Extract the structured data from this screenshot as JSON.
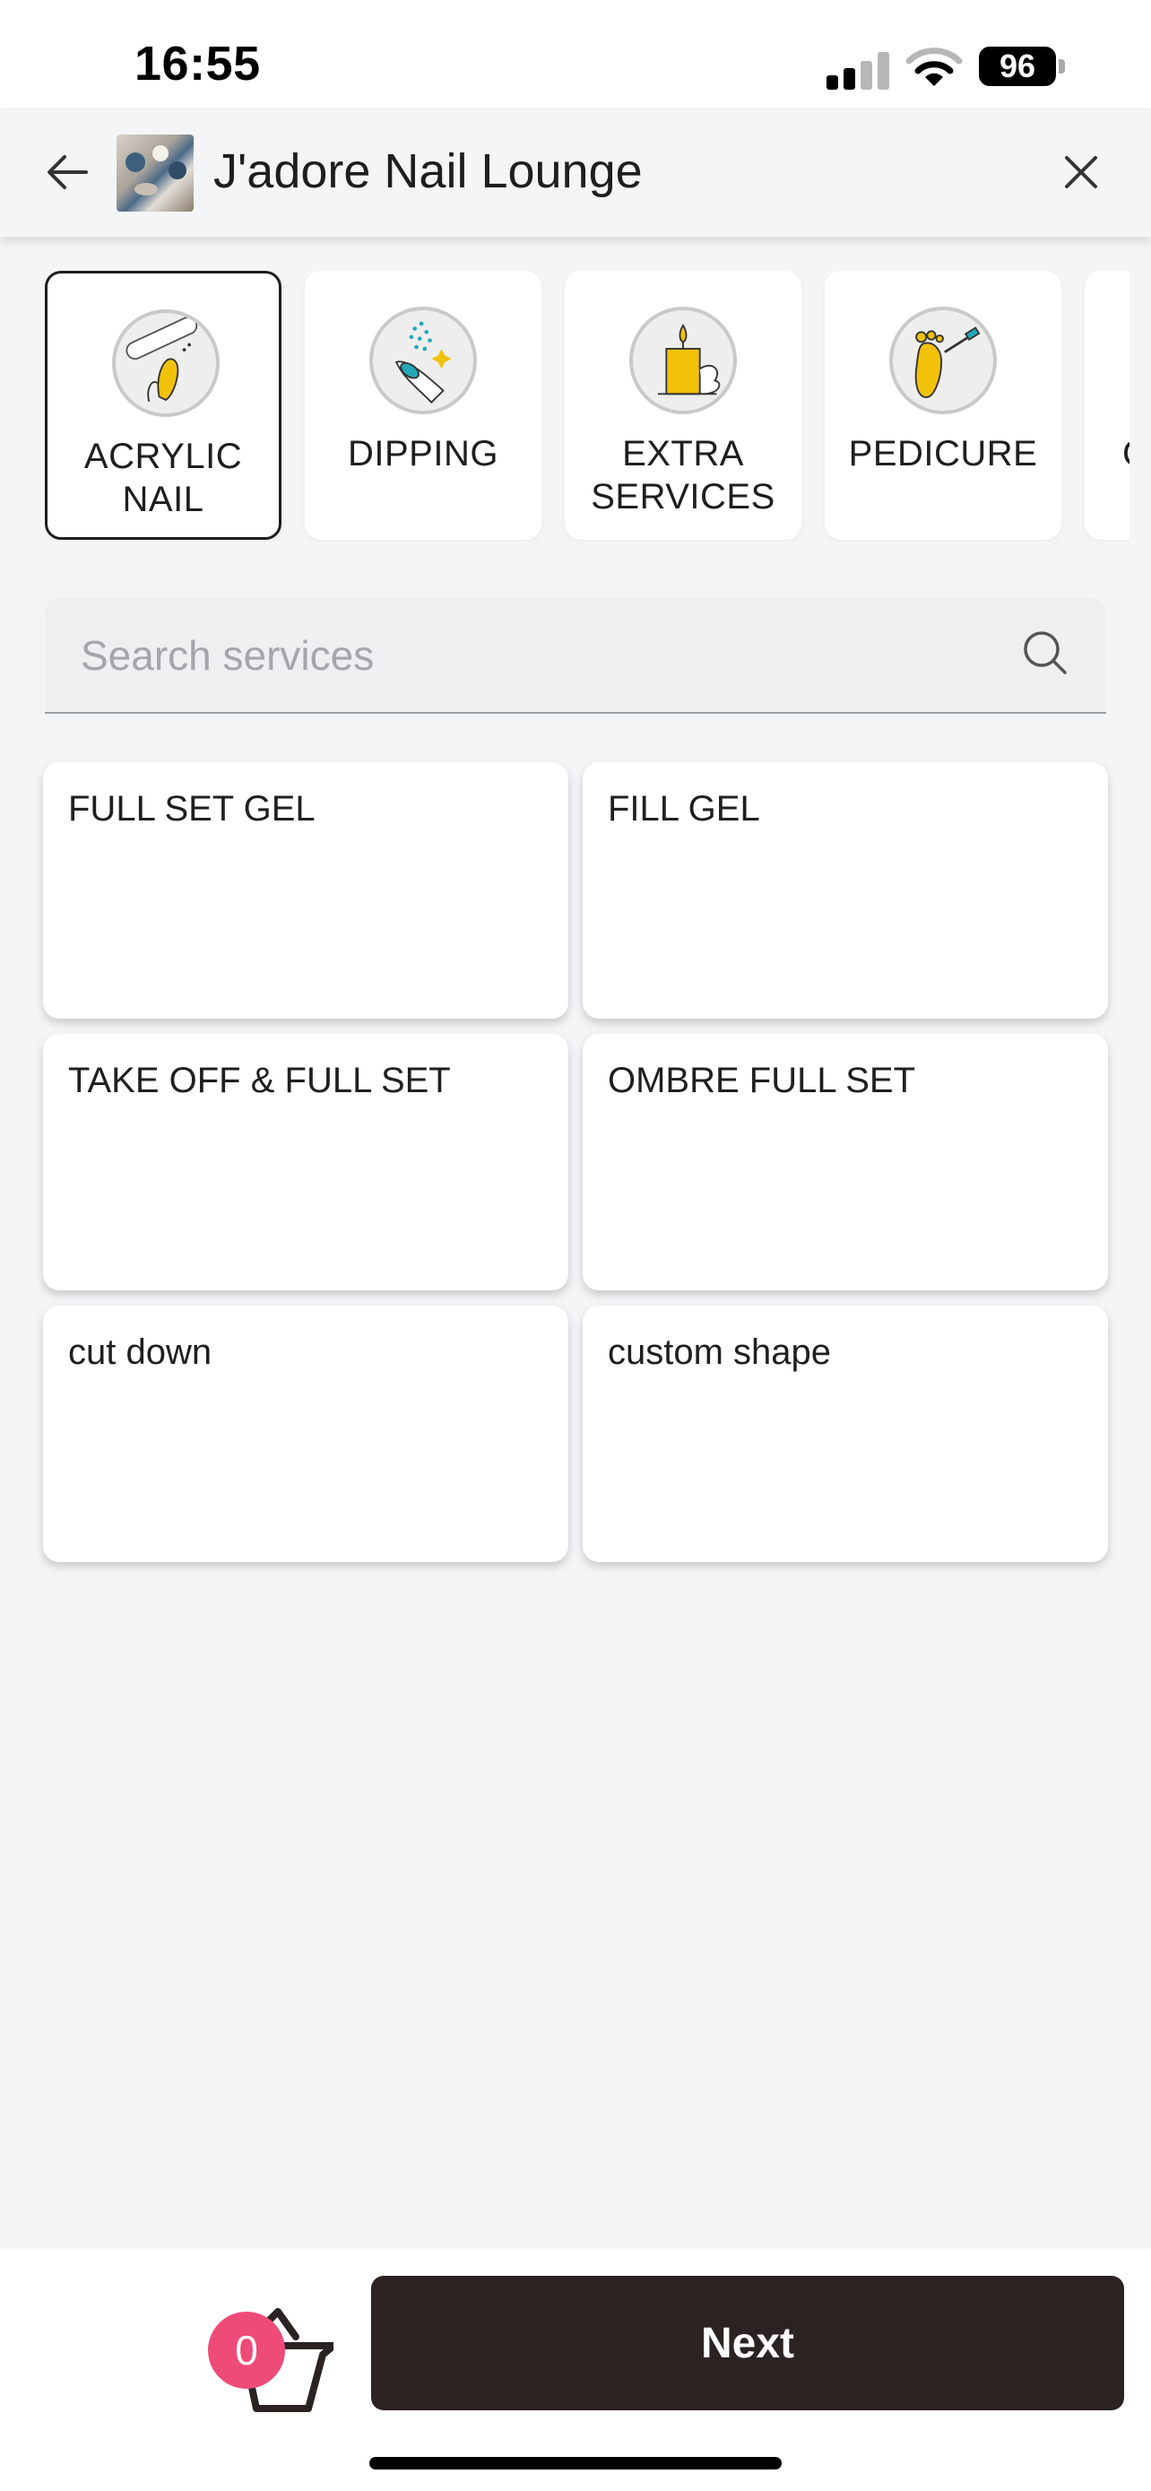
{
  "status_bar": {
    "time": "16:55",
    "battery": "96"
  },
  "header": {
    "title": "J'adore Nail Lounge"
  },
  "categories": [
    {
      "label": "ACRYLIC\nNAIL",
      "icon": "acrylic-nail-icon",
      "selected": true
    },
    {
      "label": "DIPPING",
      "icon": "dipping-icon",
      "selected": false
    },
    {
      "label": "EXTRA\nSERVICES",
      "icon": "extra-services-icon",
      "selected": false
    },
    {
      "label": "PEDICURE",
      "icon": "pedicure-icon",
      "selected": false
    },
    {
      "label": "C",
      "icon": "category-icon",
      "selected": false
    }
  ],
  "search": {
    "placeholder": "Search services",
    "value": ""
  },
  "services": [
    {
      "name": "FULL SET GEL"
    },
    {
      "name": "FILL GEL"
    },
    {
      "name": "TAKE OFF & FULL SET"
    },
    {
      "name": "OMBRE FULL SET"
    },
    {
      "name": "cut down"
    },
    {
      "name": "custom shape"
    }
  ],
  "cart": {
    "count": "0"
  },
  "footer": {
    "next_label": "Next"
  },
  "colors": {
    "accent_dark": "#2a2321",
    "badge": "#ef4b78",
    "icon_yellow": "#f2c20a",
    "icon_teal": "#25a7b8"
  }
}
